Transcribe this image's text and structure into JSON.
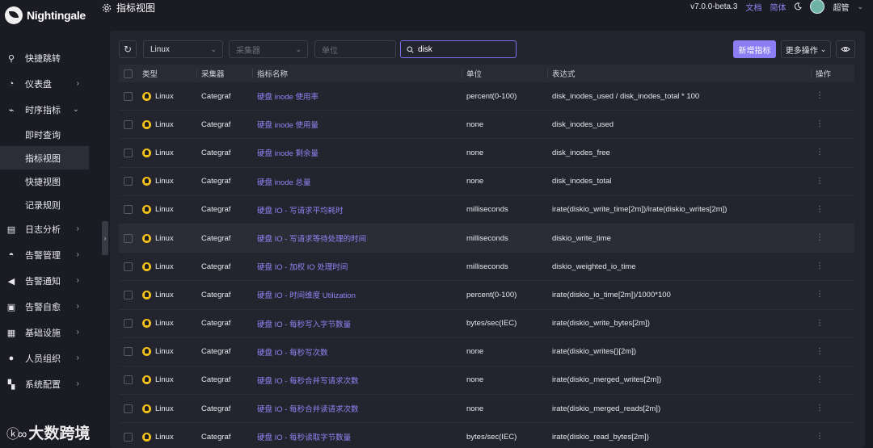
{
  "app": {
    "name": "Nightingale"
  },
  "header": {
    "title": "指标视图",
    "version": "v7.0.0-beta.3",
    "docs_label": "文档",
    "lang_label": "简体",
    "username": "超管"
  },
  "sidebar": {
    "items": [
      {
        "label": "快捷跳转",
        "icon": "search-icon",
        "has_chevron": false
      },
      {
        "label": "仪表盘",
        "icon": "dashboard-icon",
        "has_chevron": true
      },
      {
        "label": "时序指标",
        "icon": "chart-icon",
        "has_chevron": true,
        "expanded": true,
        "children": [
          {
            "label": "即时查询"
          },
          {
            "label": "指标视图",
            "active": true
          },
          {
            "label": "快捷视图"
          },
          {
            "label": "记录规则"
          }
        ]
      },
      {
        "label": "日志分析",
        "icon": "log-icon",
        "has_chevron": true
      },
      {
        "label": "告警管理",
        "icon": "bell-icon",
        "has_chevron": true
      },
      {
        "label": "告警通知",
        "icon": "megaphone-icon",
        "has_chevron": true
      },
      {
        "label": "告警自愈",
        "icon": "terminal-icon",
        "has_chevron": true
      },
      {
        "label": "基础设施",
        "icon": "server-icon",
        "has_chevron": true
      },
      {
        "label": "人员组织",
        "icon": "user-icon",
        "has_chevron": true
      },
      {
        "label": "系统配置",
        "icon": "grid-icon",
        "has_chevron": true
      }
    ]
  },
  "toolbar": {
    "type_select": "Linux",
    "collector_placeholder": "采集器",
    "unit_placeholder": "单位",
    "search_value": "disk",
    "add_button": "新增指标",
    "more_button": "更多操作"
  },
  "table": {
    "columns": [
      "类型",
      "采集器",
      "指标名称",
      "单位",
      "表达式",
      "操作"
    ],
    "rows": [
      {
        "type": "Linux",
        "collector": "Categraf",
        "name": "硬盘 inode 使用率",
        "unit": "percent(0-100)",
        "expr": "disk_inodes_used / disk_inodes_total * 100"
      },
      {
        "type": "Linux",
        "collector": "Categraf",
        "name": "硬盘 inode 使用量",
        "unit": "none",
        "expr": "disk_inodes_used"
      },
      {
        "type": "Linux",
        "collector": "Categraf",
        "name": "硬盘 inode 剩余量",
        "unit": "none",
        "expr": "disk_inodes_free"
      },
      {
        "type": "Linux",
        "collector": "Categraf",
        "name": "硬盘 inode 总量",
        "unit": "none",
        "expr": "disk_inodes_total"
      },
      {
        "type": "Linux",
        "collector": "Categraf",
        "name": "硬盘 IO - 写请求平均耗时",
        "unit": "milliseconds",
        "expr": "irate(diskio_write_time[2m])/irate(diskio_writes[2m])"
      },
      {
        "type": "Linux",
        "collector": "Categraf",
        "name": "硬盘 IO - 写请求等待处理的时间",
        "unit": "milliseconds",
        "expr": "diskio_write_time",
        "highlighted": true
      },
      {
        "type": "Linux",
        "collector": "Categraf",
        "name": "硬盘 IO - 加权 IO 处理时间",
        "unit": "milliseconds",
        "expr": "diskio_weighted_io_time"
      },
      {
        "type": "Linux",
        "collector": "Categraf",
        "name": "硬盘 IO - 时间维度 Utilization",
        "unit": "percent(0-100)",
        "expr": "irate(diskio_io_time[2m])/1000*100"
      },
      {
        "type": "Linux",
        "collector": "Categraf",
        "name": "硬盘 IO - 每秒写入字节数量",
        "unit": "bytes/sec(IEC)",
        "expr": "irate(diskio_write_bytes[2m])"
      },
      {
        "type": "Linux",
        "collector": "Categraf",
        "name": "硬盘 IO - 每秒写次数",
        "unit": "none",
        "expr": "irate(diskio_writes{}[2m])"
      },
      {
        "type": "Linux",
        "collector": "Categraf",
        "name": "硬盘 IO - 每秒合并写请求次数",
        "unit": "none",
        "expr": "irate(diskio_merged_writes[2m])"
      },
      {
        "type": "Linux",
        "collector": "Categraf",
        "name": "硬盘 IO - 每秒合并读请求次数",
        "unit": "none",
        "expr": "irate(diskio_merged_reads[2m])"
      },
      {
        "type": "Linux",
        "collector": "Categraf",
        "name": "硬盘 IO - 每秒读取字节数量",
        "unit": "bytes/sec(IEC)",
        "expr": "irate(diskio_read_bytes[2m])"
      }
    ]
  },
  "watermark": {
    "text": "大数跨境"
  },
  "colors": {
    "accent": "#8b7ef5",
    "link": "#8f86f5",
    "linux": "#f2c21b",
    "background": "#1b1b23",
    "panel": "#24242e"
  }
}
